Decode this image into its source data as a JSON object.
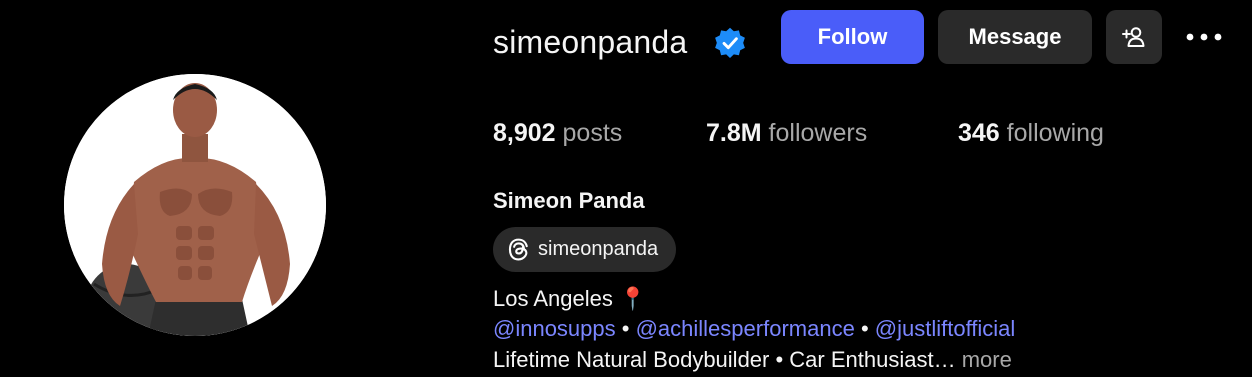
{
  "profile": {
    "username": "simeonpanda",
    "verified": true,
    "full_name": "Simeon Panda"
  },
  "actions": {
    "follow_label": "Follow",
    "message_label": "Message",
    "add_user_icon": "add-user-icon",
    "more_icon": "more-options-icon"
  },
  "stats": {
    "posts": {
      "value": "8,902",
      "label": "posts"
    },
    "followers": {
      "value": "7.8M",
      "label": "followers"
    },
    "following": {
      "value": "346",
      "label": "following"
    }
  },
  "threads": {
    "icon": "threads-icon",
    "handle": "simeonpanda"
  },
  "bio": {
    "location": "Los Angeles",
    "location_emoji": "📍",
    "mentions": [
      "@innosupps",
      "@achillesperformance",
      "@justliftofficial"
    ],
    "separator": "•",
    "description": "Lifetime Natural Bodybuilder • Car Enthusiast…",
    "more_label": "more"
  },
  "colors": {
    "background": "#000000",
    "follow_button": "#4a5df9",
    "secondary_button": "#2a2a2a",
    "link": "#7b86ff",
    "verified_badge": "#1d8cf8",
    "muted_text": "#a8a8a8"
  }
}
